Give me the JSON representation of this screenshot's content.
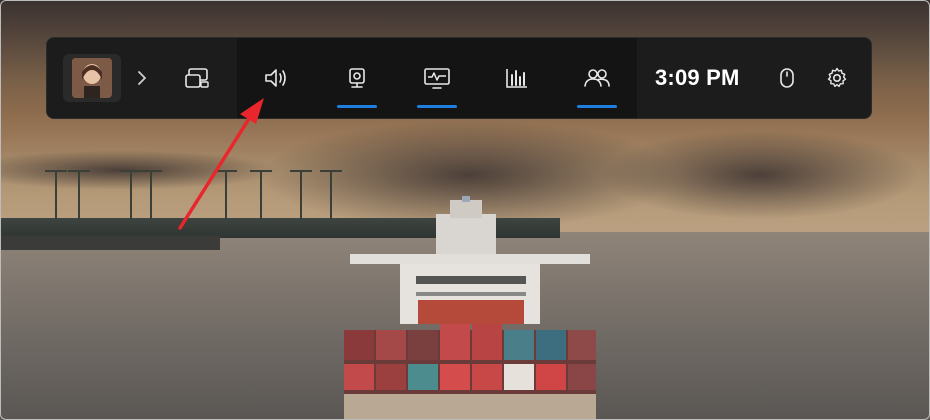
{
  "gamebar": {
    "clock": "3:09 PM",
    "widgets": [
      {
        "name": "widget-menu",
        "icon": "widgets-icon",
        "active": false
      },
      {
        "name": "audio",
        "icon": "speaker-icon",
        "active": false
      },
      {
        "name": "capture",
        "icon": "webcam-icon",
        "active": true
      },
      {
        "name": "performance",
        "icon": "monitor-icon",
        "active": true
      },
      {
        "name": "resources",
        "icon": "bar-chart-icon",
        "active": false
      },
      {
        "name": "xbox-social",
        "icon": "people-icon",
        "active": true
      }
    ],
    "right_icons": [
      "mouse-icon",
      "gear-icon"
    ]
  },
  "colors": {
    "accent": "#1f7fe0",
    "annotation_arrow": "#e8262b",
    "bar_bg": "#141414"
  }
}
